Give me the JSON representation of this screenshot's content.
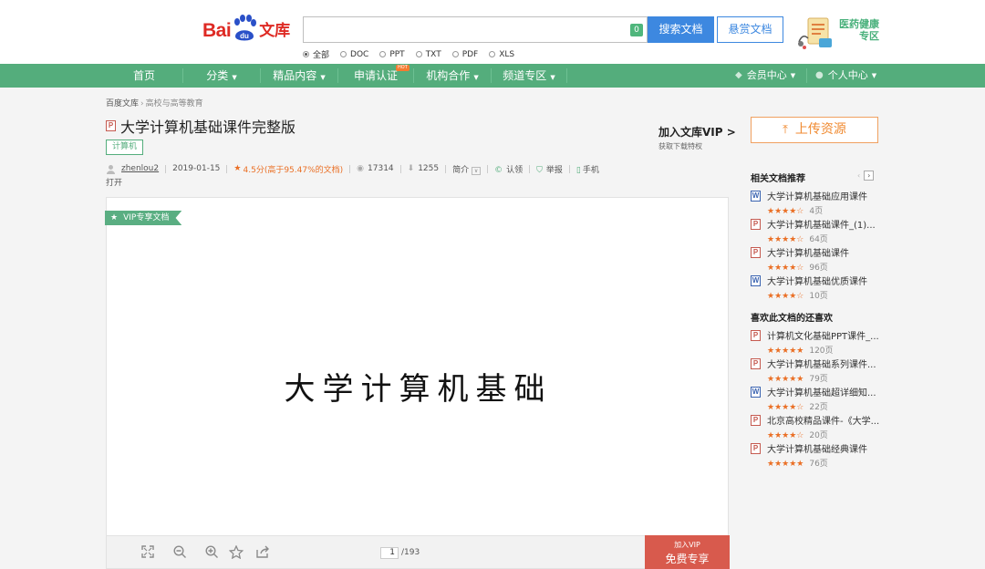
{
  "logo": {
    "bai": "Bai",
    "du": "du",
    "wenku": "文库"
  },
  "search": {
    "value": "",
    "count": "0",
    "button": "搜索文档",
    "reward_button": "悬赏文档"
  },
  "health": {
    "line1": "医药健康",
    "line2": "专区"
  },
  "filters": [
    {
      "label": "全部",
      "selected": true
    },
    {
      "label": "DOC",
      "selected": false
    },
    {
      "label": "PPT",
      "selected": false
    },
    {
      "label": "TXT",
      "selected": false
    },
    {
      "label": "PDF",
      "selected": false
    },
    {
      "label": "XLS",
      "selected": false
    }
  ],
  "nav": {
    "home": "首页",
    "category": "分类",
    "premium": "精品内容",
    "certify": "申请认证",
    "hot_badge": "HOT",
    "cooperation": "机构合作",
    "channel": "频道专区",
    "member_center": "会员中心",
    "personal_center": "个人中心"
  },
  "breadcrumb": {
    "root": "百度文库",
    "sep": "›",
    "current": "高校与高等教育"
  },
  "doc": {
    "file_type": "P",
    "title": "大学计算机基础课件完整版",
    "tag": "计算机",
    "author": "zhenlou2",
    "date": "2019-01-15",
    "rating": "4.5分(高于95.47%的文档)",
    "views": "17314",
    "downloads": "1255",
    "intro": "简介",
    "claim": "认领",
    "report": "举报",
    "mobile": "手机",
    "open": "打开"
  },
  "vip_join": {
    "title": "加入文库VIP >",
    "subtitle": "获取下载特权"
  },
  "preview": {
    "ribbon": "VIP专享文档",
    "slide_text": "大学计算机基础",
    "page_current": "1",
    "page_total": "/193",
    "vip_line1": "加入VIP",
    "vip_line2": "免费专享"
  },
  "sidebar": {
    "upload": "上传资源",
    "related_title": "相关文档推荐",
    "related": [
      {
        "type": "W",
        "title": "大学计算机基础应用课件",
        "stars": "★★★★☆",
        "pages": "4页"
      },
      {
        "type": "P",
        "title": "大学计算机基础课件_(1)...",
        "stars": "★★★★☆",
        "pages": "64页"
      },
      {
        "type": "P",
        "title": "大学计算机基础课件",
        "stars": "★★★★☆",
        "pages": "96页"
      },
      {
        "type": "W",
        "title": "大学计算机基础优质课件",
        "stars": "★★★★☆",
        "pages": "10页"
      }
    ],
    "liked_title": "喜欢此文档的还喜欢",
    "liked": [
      {
        "type": "P",
        "title": "计算机文化基础PPT课件_...",
        "stars": "★★★★★",
        "pages": "120页"
      },
      {
        "type": "P",
        "title": "大学计算机基础系列课件...",
        "stars": "★★★★★",
        "pages": "79页"
      },
      {
        "type": "W",
        "title": "大学计算机基础超详细知...",
        "stars": "★★★★☆",
        "pages": "22页"
      },
      {
        "type": "P",
        "title": "北京高校精品课件-《大学...",
        "stars": "★★★★☆",
        "pages": "20页"
      },
      {
        "type": "P",
        "title": "大学计算机基础经典课件",
        "stars": "★★★★★",
        "pages": "76页"
      }
    ]
  },
  "colors": {
    "green": "#54ad7c",
    "blue": "#3d88e0",
    "orange": "#ea6f25",
    "red": "#d85a4d"
  }
}
